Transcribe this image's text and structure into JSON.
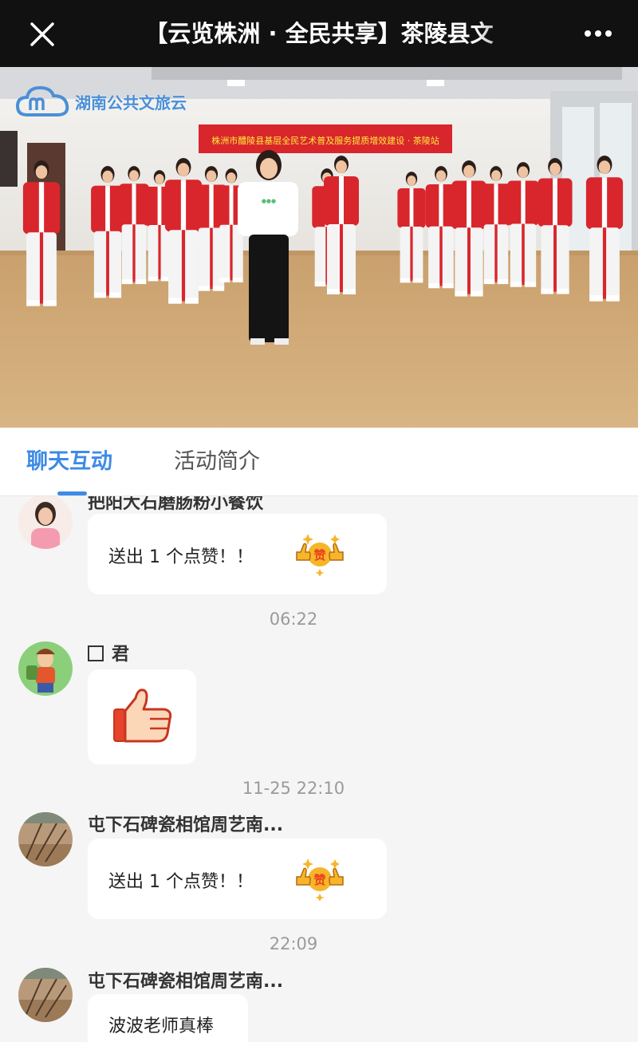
{
  "header": {
    "title": "【云览株洲 · 全民共享】茶陵县文",
    "close_icon": "close-icon",
    "more_icon": "more-icon"
  },
  "video": {
    "brand": "湖南公共文旅云",
    "banner": "株洲市醴陵县基层全民艺术普及服务提质增效建设 · 茶陵站"
  },
  "tabs": [
    {
      "label": "聊天互动",
      "active": true
    },
    {
      "label": "活动简介",
      "active": false
    }
  ],
  "chat": {
    "messages": [
      {
        "nick": "把阳大石磨肠粉小餐饮",
        "text": "送出 1 个点赞！！",
        "type": "like"
      },
      {
        "time": "06:22"
      },
      {
        "nick": "君",
        "type": "thumb"
      },
      {
        "time": "11-25 22:10"
      },
      {
        "nick": "屯下石碑瓷相馆周艺南...",
        "text": "送出 1 个点赞！！",
        "type": "like"
      },
      {
        "time": "22:09"
      },
      {
        "nick": "屯下石碑瓷相馆周艺南...",
        "text": "波波老师真棒",
        "type": "text"
      }
    ]
  },
  "colors": {
    "accent": "#3d8be6",
    "topbar": "#111111",
    "uniform_red": "#d8262c"
  }
}
